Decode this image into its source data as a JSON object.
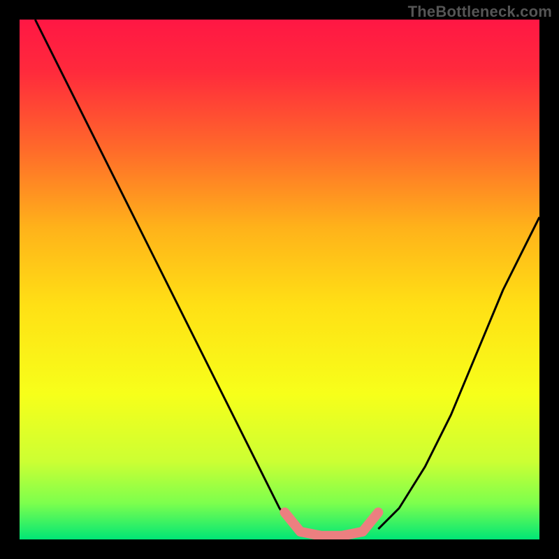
{
  "watermark": "TheBottleneck.com",
  "chart_data": {
    "type": "line",
    "title": "",
    "xlabel": "",
    "ylabel": "",
    "xlim": [
      0,
      100
    ],
    "ylim": [
      0,
      100
    ],
    "grid": false,
    "legend": false,
    "gradient_stops": [
      {
        "offset": 0.0,
        "color": "#ff1744"
      },
      {
        "offset": 0.1,
        "color": "#ff2a3c"
      },
      {
        "offset": 0.25,
        "color": "#ff6a2a"
      },
      {
        "offset": 0.4,
        "color": "#ffb21a"
      },
      {
        "offset": 0.55,
        "color": "#ffe015"
      },
      {
        "offset": 0.72,
        "color": "#f7ff1a"
      },
      {
        "offset": 0.85,
        "color": "#ccff33"
      },
      {
        "offset": 0.93,
        "color": "#7dff4d"
      },
      {
        "offset": 1.0,
        "color": "#00e676"
      }
    ],
    "series": [
      {
        "name": "left-curve",
        "stroke": "#000000",
        "stroke_width": 3,
        "x": [
          3,
          8,
          14,
          20,
          26,
          32,
          38,
          44,
          50,
          53
        ],
        "y": [
          100,
          90,
          78,
          66,
          54,
          42,
          30,
          18,
          6,
          2
        ]
      },
      {
        "name": "right-curve",
        "stroke": "#000000",
        "stroke_width": 3,
        "x": [
          69,
          73,
          78,
          83,
          88,
          93,
          98,
          100
        ],
        "y": [
          2,
          6,
          14,
          24,
          36,
          48,
          58,
          62
        ]
      },
      {
        "name": "bottom-valley-highlight",
        "stroke": "#ec7f80",
        "stroke_width": 14,
        "linecap": "round",
        "x": [
          51,
          54,
          58,
          62,
          66,
          69
        ],
        "y": [
          5.2,
          1.5,
          0.7,
          0.7,
          1.5,
          5.2
        ]
      }
    ]
  }
}
